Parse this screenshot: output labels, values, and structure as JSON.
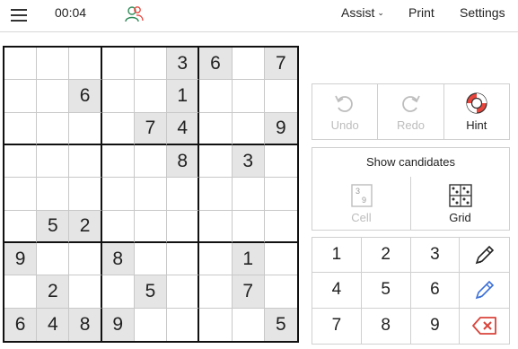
{
  "topbar": {
    "timer": "00:04",
    "assist_label": "Assist",
    "print_label": "Print",
    "settings_label": "Settings"
  },
  "board": {
    "rows": [
      [
        "",
        "",
        "",
        "",
        "",
        "3",
        "6",
        "",
        "7"
      ],
      [
        "",
        "",
        "6",
        "",
        "",
        "1",
        "",
        "",
        ""
      ],
      [
        "",
        "",
        "",
        "",
        "7",
        "4",
        "",
        "",
        "9"
      ],
      [
        "",
        "",
        "",
        "",
        "",
        "8",
        "",
        "3",
        ""
      ],
      [
        "",
        "",
        "",
        "",
        "",
        "",
        "",
        "",
        ""
      ],
      [
        "",
        "5",
        "2",
        "",
        "",
        "",
        "",
        "",
        ""
      ],
      [
        "9",
        "",
        "",
        "8",
        "",
        "",
        "",
        "1",
        ""
      ],
      [
        "",
        "2",
        "",
        "",
        "5",
        "",
        "",
        "7",
        ""
      ],
      [
        "6",
        "4",
        "8",
        "9",
        "",
        "",
        "",
        "",
        "5"
      ]
    ]
  },
  "actions": {
    "undo_label": "Undo",
    "redo_label": "Redo",
    "hint_label": "Hint"
  },
  "candidates": {
    "title": "Show candidates",
    "cell_label": "Cell",
    "grid_label": "Grid",
    "cell_icon_top": "3",
    "cell_icon_bottom": "9"
  },
  "keypad": {
    "digits": [
      "1",
      "2",
      "3",
      "4",
      "5",
      "6",
      "7",
      "8",
      "9"
    ]
  },
  "colors": {
    "given_bg": "#e5e5e5",
    "hint_red": "#e8453c",
    "pencil_blue": "#3a6fd8",
    "erase_red": "#d9443b",
    "users_green": "#2e8b57"
  },
  "icons": [
    "menu-icon",
    "users-icon",
    "undo-icon",
    "redo-icon",
    "lifebuoy-icon",
    "candidate-cell-icon",
    "candidate-grid-icon",
    "pencil-icon",
    "pencil-blue-icon",
    "erase-icon"
  ]
}
